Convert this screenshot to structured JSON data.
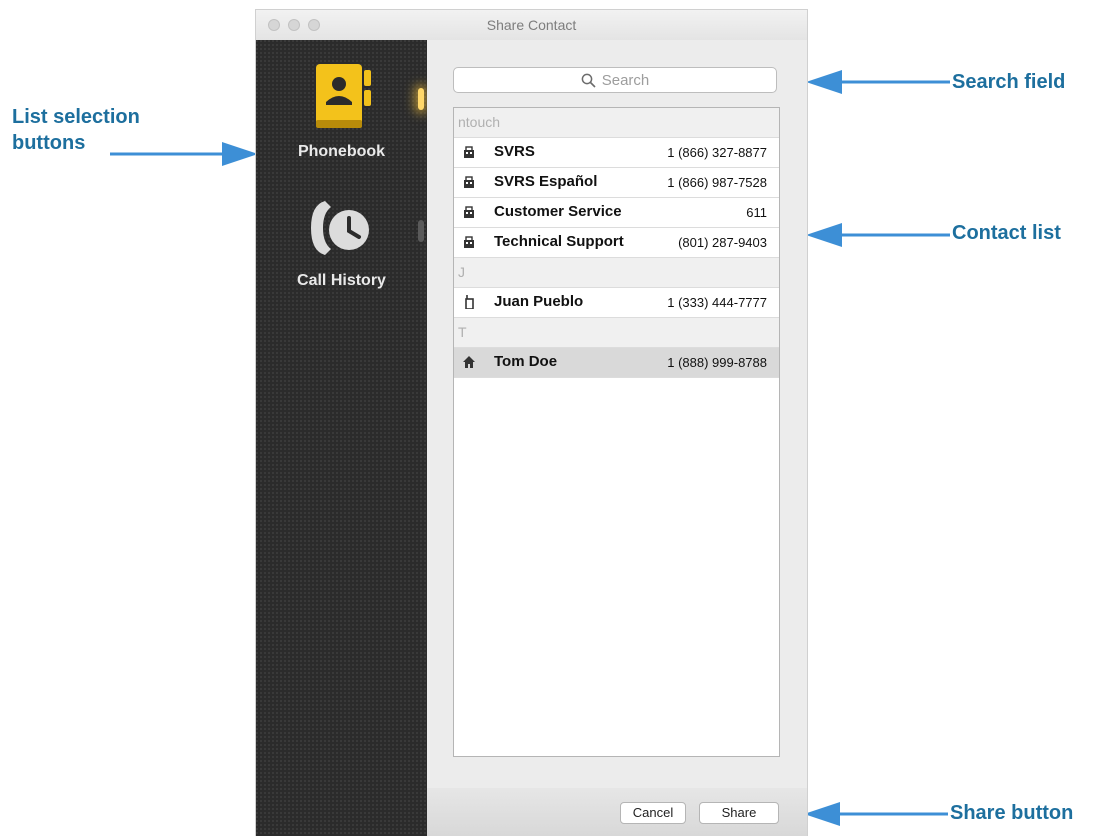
{
  "window": {
    "title": "Share Contact"
  },
  "sidebar": {
    "items": [
      {
        "label": "Phonebook",
        "icon": "phonebook-icon"
      },
      {
        "label": "Call History",
        "icon": "call-history-icon"
      }
    ]
  },
  "search": {
    "placeholder": "Search",
    "value": ""
  },
  "contacts": {
    "sections": [
      {
        "header": "ntouch",
        "rows": [
          {
            "name": "SVRS",
            "phone": "1 (866) 327-8877",
            "icon": "building-icon"
          },
          {
            "name": "SVRS Español",
            "phone": "1 (866) 987-7528",
            "icon": "building-icon"
          },
          {
            "name": "Customer Service",
            "phone": "611",
            "icon": "building-icon"
          },
          {
            "name": "Technical Support",
            "phone": "(801) 287-9403",
            "icon": "building-icon"
          }
        ]
      },
      {
        "header": "J",
        "rows": [
          {
            "name": "Juan Pueblo",
            "phone": "1 (333) 444-7777",
            "icon": "mobile-icon"
          }
        ]
      },
      {
        "header": "T",
        "rows": [
          {
            "name": "Tom Doe",
            "phone": "1 (888) 999-8788",
            "icon": "home-icon",
            "selected": true
          }
        ]
      }
    ]
  },
  "footer": {
    "cancel_label": "Cancel",
    "share_label": "Share"
  },
  "annotations": {
    "list_selection_line1": "List selection",
    "list_selection_line2": "buttons",
    "search_field": "Search field",
    "contact_list": "Contact list",
    "share_button": "Share button"
  },
  "colors": {
    "annotation": "#1d6f9e",
    "arrow": "#3d8fd6",
    "phonebook_accent": "#f3c21b",
    "sidebar_bg": "#2b2b2b",
    "selected_row": "#d9d9d9"
  }
}
